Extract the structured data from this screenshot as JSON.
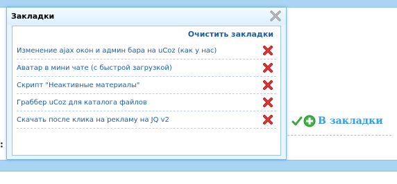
{
  "dialog": {
    "title": "Закладки",
    "clear_label": "Очистить закладки",
    "items": [
      {
        "label": "Изменение ajax окон и админ бара на uCoz (как у нас)",
        "icon": "delete-icon"
      },
      {
        "label": "Аватар в мини чате (с быстрой загрузкой)",
        "icon": "delete-icon"
      },
      {
        "label": "Скрипт \"Неактивные материалы\"",
        "icon": "delete-icon"
      },
      {
        "label": "Граббер uCoz для каталога файлов",
        "icon": "delete-icon"
      },
      {
        "label": "Скачать после клика на рекламу на JQ v2",
        "icon": "delete-icon"
      }
    ]
  },
  "page": {
    "add_bookmark_label": "В закладки",
    "cut_text": ": С"
  },
  "colors": {
    "link": "#1b5fa6",
    "accent": "#3a9fe2",
    "delete": "#d11f1f",
    "background": "#a9d4f3"
  }
}
